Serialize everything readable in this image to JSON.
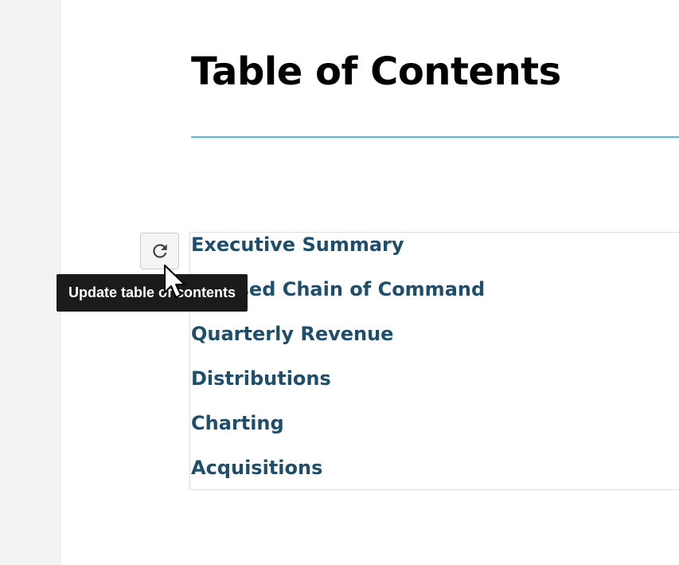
{
  "document": {
    "title": "Table of Contents",
    "toc_entries": [
      "Executive Summary",
      "Revised Chain of Command",
      "Quarterly Revenue",
      "Distributions",
      "Charting",
      "Acquisitions"
    ]
  },
  "toolbar": {
    "update_button_icon": "refresh-icon",
    "tooltip_text": "Update table of contents"
  },
  "colors": {
    "title_rule": "#5bb8d9",
    "toc_link": "#1f4e6b",
    "tooltip_bg": "#1b1b1b"
  }
}
